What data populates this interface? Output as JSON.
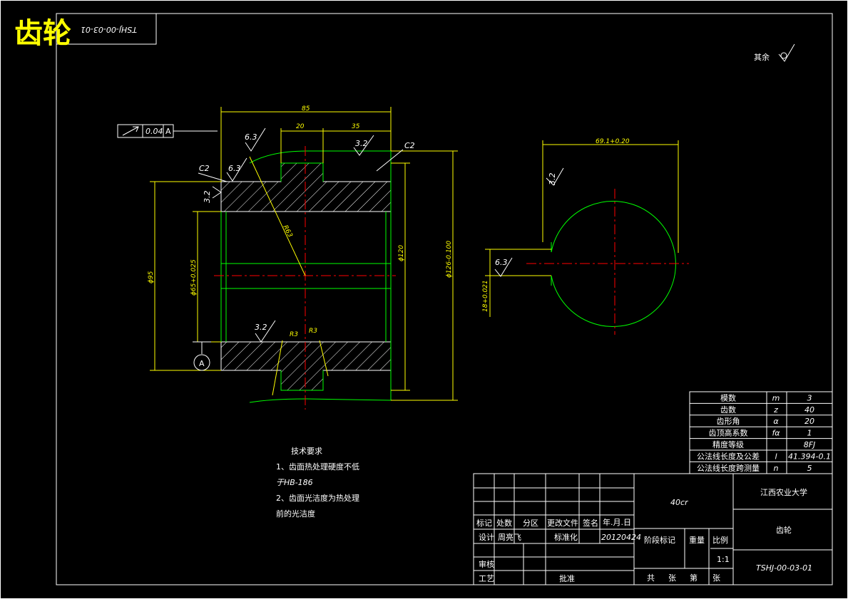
{
  "title": "齿轮",
  "drawing_code_mirrored": "TSHJ-00-03-01",
  "roughness_note": "其余",
  "tolerance_frame": {
    "value": "0.04",
    "datum": "A"
  },
  "dims": {
    "len85": "85",
    "len20": "20",
    "len35": "35",
    "c2a": "C2",
    "c2b": "C2",
    "r63": "R63",
    "d95": "ϕ95",
    "d65": "ϕ65+0.025",
    "d120": "ϕ120",
    "d126": "ϕ126-0.100",
    "r3a": "R3",
    "r3b": "R3",
    "rough_32_a": "3.2",
    "rough_32_b": "3.2",
    "rough_32_c": "3.2",
    "rough_63_a": "6.3",
    "rough_63_b": "6.3",
    "rough_63_c": "6.3",
    "rough_32_d": "3.2",
    "key_width": "69.1+0.20",
    "key_depth": "18+0.021",
    "datum_label": "A"
  },
  "tech_req": {
    "heading": "技术要求",
    "line1": "1、齿面热处理硬度不低",
    "line2": "于HB-186",
    "line3": "2、齿面光洁度为热处理",
    "line4": "前的光洁度"
  },
  "param_table": [
    {
      "name": "模数",
      "sym": "m",
      "val": "3"
    },
    {
      "name": "齿数",
      "sym": "z",
      "val": "40"
    },
    {
      "name": "齿形角",
      "sym": "α",
      "val": "20"
    },
    {
      "name": "齿顶高系数",
      "sym": "fα",
      "val": "1"
    },
    {
      "name": "精度等级",
      "sym": "",
      "val": "8FJ"
    },
    {
      "name": "公法线长度及公差",
      "sym": "l",
      "val": "41.394-0.1"
    },
    {
      "name": "公法线长度跨测量",
      "sym": "n",
      "val": "5"
    }
  ],
  "title_block": {
    "material": "40cr",
    "school": "江西农业大学",
    "part_name": "齿轮",
    "code": "TSHJ-00-03-01",
    "h_biaoji": "标记",
    "h_chushu": "处数",
    "h_fenqu": "分区",
    "h_gengwen": "更改文件",
    "h_qianming": "签名",
    "h_date": "年.月.日",
    "sheji": "设计",
    "designer": "周亮飞",
    "biaozhunhua": "标准化",
    "date": "20120424",
    "jieduan": "阶段标记",
    "zhongliang": "重量",
    "bili": "比例",
    "scale": "1:1",
    "shenhe": "审核",
    "gongyi": "工艺",
    "pizhun": "批准",
    "gong": "共",
    "zhang1": "张",
    "di": "第",
    "zhang2": "张"
  }
}
